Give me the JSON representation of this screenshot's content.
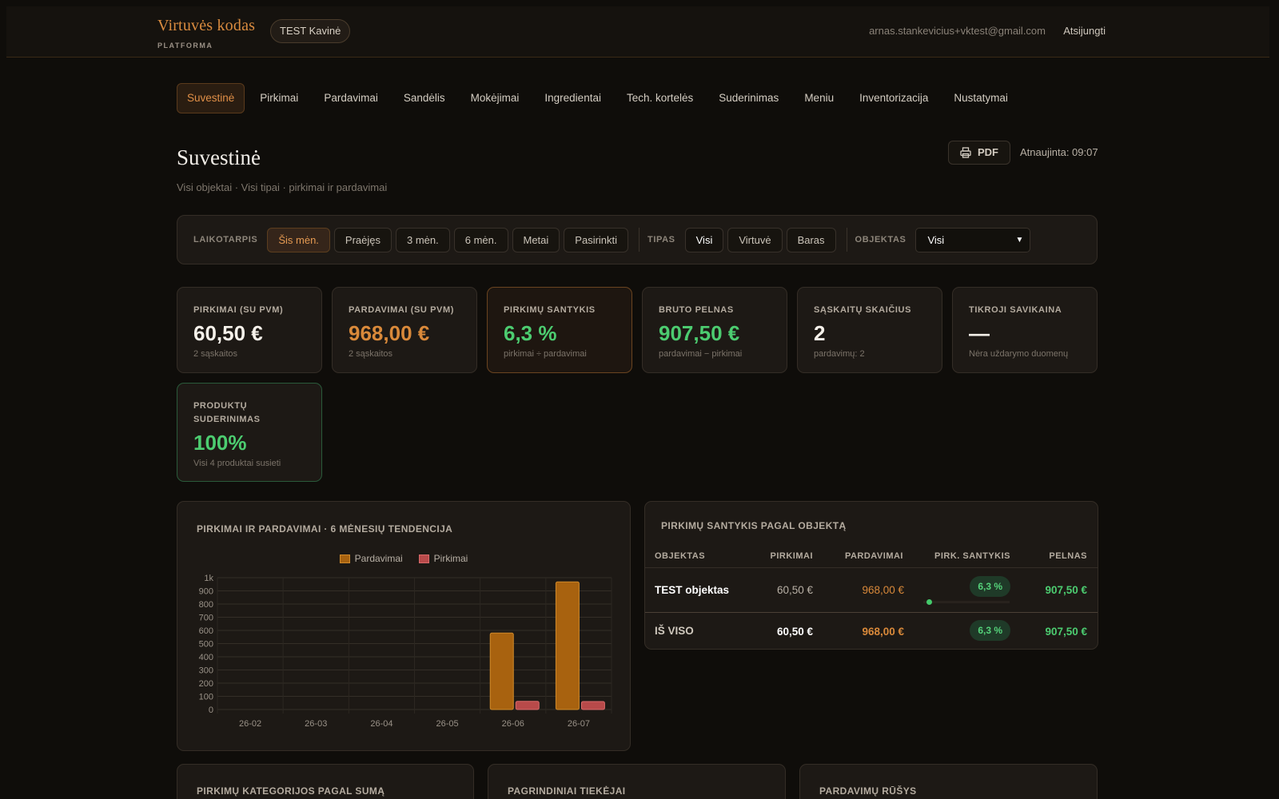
{
  "header": {
    "brand_name": "Virtuvės kodas",
    "brand_sub": "PLATFORMA",
    "org": "TEST Kavinė",
    "user_email": "arnas.stankevicius+vktest@gmail.com",
    "logout": "Atsijungti"
  },
  "nav": [
    {
      "label": "Suvestinė",
      "active": true
    },
    {
      "label": "Pirkimai"
    },
    {
      "label": "Pardavimai"
    },
    {
      "label": "Sandėlis"
    },
    {
      "label": "Mokėjimai"
    },
    {
      "label": "Ingredientai"
    },
    {
      "label": "Tech. kortelės"
    },
    {
      "label": "Suderinimas"
    },
    {
      "label": "Meniu"
    },
    {
      "label": "Inventorizacija"
    },
    {
      "label": "Nustatymai"
    }
  ],
  "page": {
    "title": "Suvestinė",
    "subtitle": "Visi objektai · Visi tipai · pirkimai ir pardavimai",
    "pdf_label": "PDF",
    "updated": "Atnaujinta: 09:07"
  },
  "filters": {
    "period_label": "LAIKOTARPIS",
    "periods": [
      "Šis mėn.",
      "Praėjęs",
      "3 mėn.",
      "6 mėn.",
      "Metai",
      "Pasirinkti"
    ],
    "active_period": "Šis mėn.",
    "type_label": "TIPAS",
    "types": [
      "Visi",
      "Virtuvė",
      "Baras"
    ],
    "active_type": "Visi",
    "object_label": "OBJEKTAS",
    "object_value": "Visi"
  },
  "kpis": [
    {
      "label": "PIRKIMAI (SU PVM)",
      "value": "60,50 €",
      "sub": "2 sąskaitos",
      "color": "#f5f1ea"
    },
    {
      "label": "PARDAVIMAI (SU PVM)",
      "value": "968,00 €",
      "sub": "2 sąskaitos",
      "color": "#d9893a"
    },
    {
      "label": "PIRKIMŲ SANTYKIS",
      "value": "6,3 %",
      "sub": "pirkimai ÷ pardavimai",
      "color": "#4ccc70"
    },
    {
      "label": "BRUTO PELNAS",
      "value": "907,50 €",
      "sub": "pardavimai − pirkimai",
      "color": "#4ccc70"
    },
    {
      "label": "SĄSKAITŲ SKAIČIUS",
      "value": "2",
      "sub": "pardavimų: 2",
      "color": "#f5f1ea"
    },
    {
      "label": "TIKROJI SAVIKAINA",
      "value": "—",
      "sub": "Nėra uždarymo duomenų",
      "color": "#f5f1ea"
    },
    {
      "label": "PRODUKTŲ SUDERINIMAS",
      "value": "100%",
      "sub": "Visi 4 produktai susieti",
      "color": "#4ccc70"
    }
  ],
  "trend_panel": {
    "title": "PIRKIMAI IR PARDAVIMAI · 6 MĖNESIŲ TENDENCIJA"
  },
  "chart_data": {
    "type": "bar",
    "categories": [
      "26-02",
      "26-03",
      "26-04",
      "26-05",
      "26-06",
      "26-07"
    ],
    "series": [
      {
        "name": "Pardavimai",
        "values": [
          0,
          0,
          0,
          0,
          580,
          968
        ],
        "color": "#a8620f"
      },
      {
        "name": "Pirkimai",
        "values": [
          0,
          0,
          0,
          0,
          62,
          60.5
        ],
        "color": "#b84a4a"
      }
    ],
    "ylim": [
      0,
      1000
    ],
    "yticks": [
      "0",
      "100",
      "200",
      "300",
      "400",
      "500",
      "600",
      "700",
      "800",
      "900",
      "1k"
    ],
    "legend": "top-center",
    "grid": true
  },
  "ratio_panel": {
    "title": "PIRKIMŲ SANTYKIS PAGAL OBJEKTĄ",
    "columns": [
      "OBJEKTAS",
      "PIRKIMAI",
      "PARDAVIMAI",
      "PIRK. SANTYKIS",
      "PELNAS"
    ],
    "rows": [
      {
        "name": "TEST objektas",
        "pirkimai": "60,50 €",
        "pardavimai": "968,00 €",
        "santykis": "6,3 %",
        "santykis_fraction": 0.063,
        "pelnas": "907,50 €"
      }
    ],
    "total": {
      "name": "IŠ VISO",
      "pirkimai": "60,50 €",
      "pardavimai": "968,00 €",
      "santykis": "6,3 %",
      "pelnas": "907,50 €"
    }
  },
  "bottom_panels": [
    "PIRKIMŲ KATEGORIJOS PAGAL SUMĄ",
    "PAGRINDINIAI TIEKĖJAI",
    "PARDAVIMŲ RŪŠYS"
  ]
}
